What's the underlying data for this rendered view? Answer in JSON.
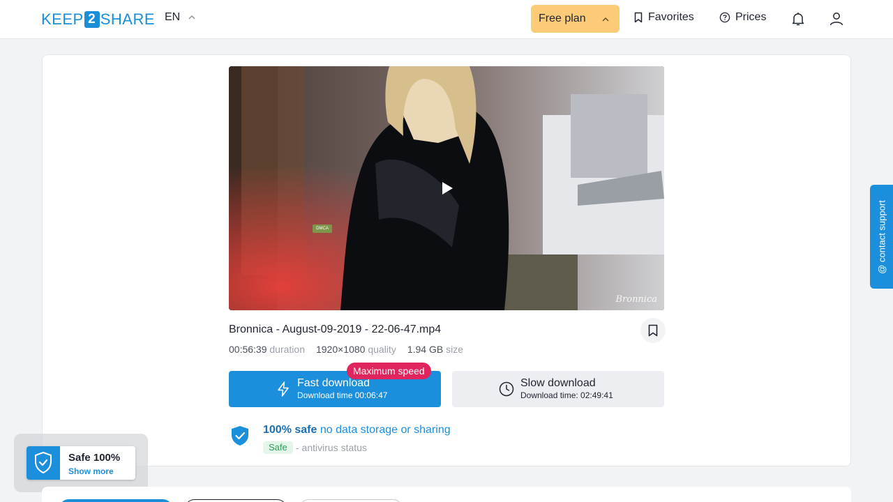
{
  "header": {
    "logo_left": "KEEP",
    "logo_mid": "2",
    "logo_right": "SHARE",
    "language": "EN",
    "plan_label": "Free plan",
    "favorites_label": "Favorites",
    "prices_label": "Prices",
    "icons": {
      "favorites": "bookmark-icon",
      "prices": "question-circle-icon",
      "notifications": "bell-icon",
      "account": "user-icon"
    }
  },
  "file": {
    "name": "Bronnica - August-09-2019 - 22-06-47.mp4",
    "duration": "00:56:39",
    "duration_label": "duration",
    "resolution": "1920×1080",
    "resolution_label": "quality",
    "size": "1.94 GB",
    "size_label": "size",
    "preview_watermark": "Bronnica",
    "preview_badge": "DMCA"
  },
  "downloads": {
    "fast_label": "Fast download",
    "fast_time": "Download time 00:06:47",
    "badge": "Maximum speed",
    "slow_label": "Slow download",
    "slow_time": "Download time: 02:49:41"
  },
  "safety": {
    "strong": "100% safe",
    "rest": "no data storage or sharing",
    "chip": "Safe",
    "status": "- antivirus status"
  },
  "support": {
    "label": "@ contact support"
  },
  "widget": {
    "title": "Safe 100%",
    "link": "Show more"
  },
  "colors": {
    "accent": "#1b8fdc",
    "plan": "#fbcb78",
    "badge": "#e0245e",
    "safe_chip": "#e4f6ea"
  }
}
